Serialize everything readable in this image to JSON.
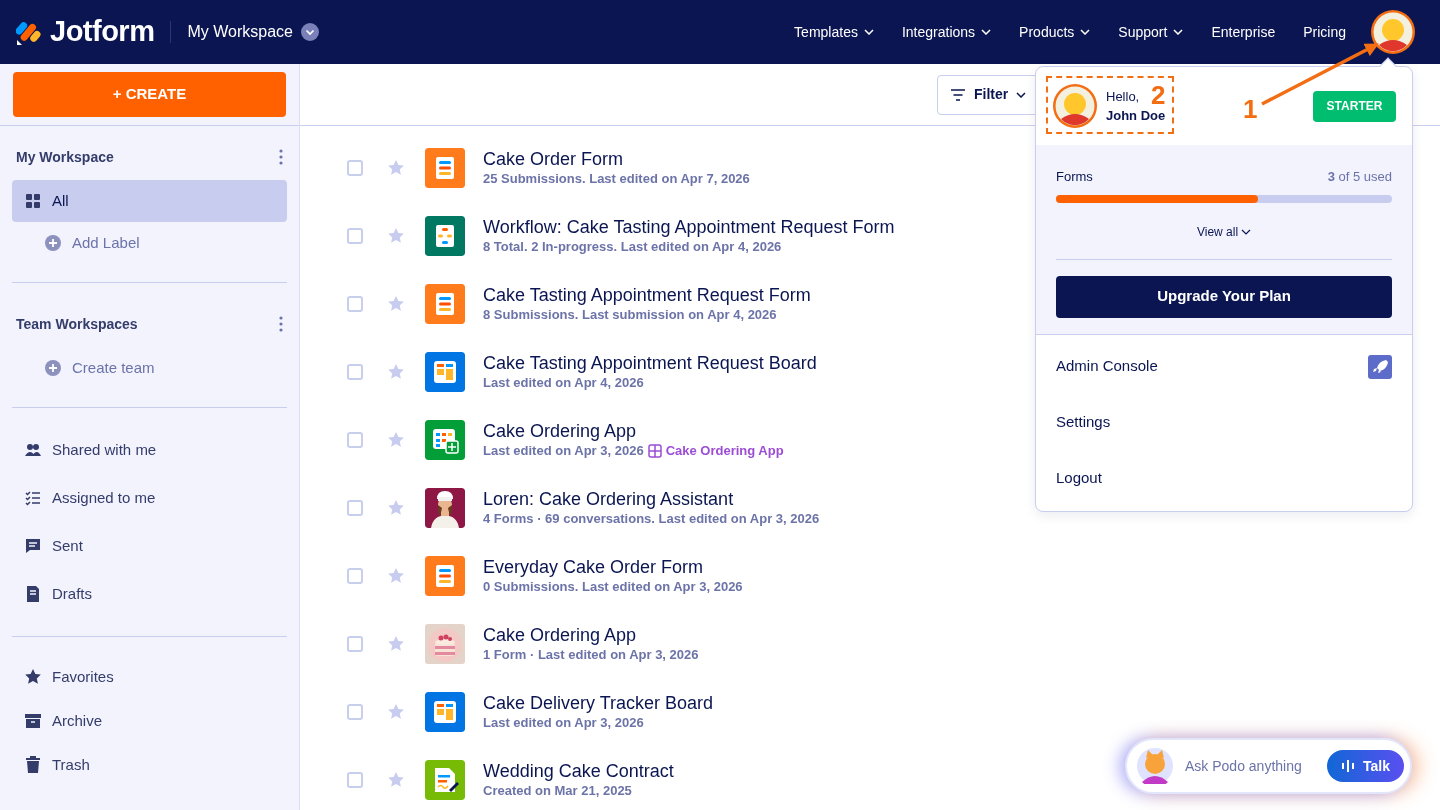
{
  "navbar": {
    "brand": "Jotform",
    "workspace": "My Workspace",
    "links": [
      {
        "label": "Templates",
        "has_menu": true
      },
      {
        "label": "Integrations",
        "has_menu": true
      },
      {
        "label": "Products",
        "has_menu": true
      },
      {
        "label": "Support",
        "has_menu": true
      },
      {
        "label": "Enterprise",
        "has_menu": false
      },
      {
        "label": "Pricing",
        "has_menu": false
      }
    ]
  },
  "sidebar": {
    "create_label": "+ CREATE",
    "sections": [
      {
        "title": "My Workspace",
        "items": [
          {
            "label": "All",
            "kind": "all",
            "selected": true
          },
          {
            "label": "Add Label",
            "kind": "add",
            "selected": false
          }
        ]
      },
      {
        "title": "Team Workspaces",
        "items": [
          {
            "label": "Create team",
            "kind": "add",
            "selected": false
          }
        ]
      },
      {
        "items": [
          {
            "label": "Shared with me",
            "kind": "shared",
            "selected": false
          },
          {
            "label": "Assigned to me",
            "kind": "assigned",
            "selected": false
          },
          {
            "label": "Sent",
            "kind": "sent",
            "selected": false
          },
          {
            "label": "Drafts",
            "kind": "drafts",
            "selected": false
          }
        ]
      },
      {
        "items": [
          {
            "label": "Favorites",
            "kind": "favorites",
            "selected": false
          },
          {
            "label": "Archive",
            "kind": "archive",
            "selected": false
          },
          {
            "label": "Trash",
            "kind": "trash",
            "selected": false
          }
        ]
      }
    ]
  },
  "toolbar": {
    "filter_label": "Filter"
  },
  "assets": [
    {
      "title": "Cake Order Form",
      "meta": "25 Submissions. Last edited on Apr 7, 2026",
      "kind": "form",
      "checked": false,
      "starred": false
    },
    {
      "title": "Workflow: Cake Tasting Appointment Request Form",
      "meta": "8 Total. 2 In-progress. Last edited on Apr 4, 2026",
      "kind": "workflow",
      "checked": false,
      "starred": false
    },
    {
      "title": "Cake Tasting Appointment Request Form",
      "meta": "8 Submissions. Last submission on Apr 4, 2026",
      "kind": "form",
      "checked": false,
      "starred": false
    },
    {
      "title": "Cake Tasting Appointment Request Board",
      "meta": "Last edited on Apr 4, 2026",
      "kind": "board",
      "checked": false,
      "starred": false
    },
    {
      "title": "Cake Ordering App",
      "meta": "Last edited on Apr 3, 2026",
      "link": "Cake Ordering App",
      "kind": "table",
      "checked": false,
      "starred": false
    },
    {
      "title": "Loren: Cake Ordering Assistant",
      "meta": "4 Forms · 69 conversations. Last edited on Apr 3, 2026",
      "kind": "agent",
      "checked": false,
      "starred": false
    },
    {
      "title": "Everyday Cake Order Form",
      "meta": "0 Submissions. Last edited on Apr 3, 2026",
      "kind": "form",
      "checked": false,
      "starred": false
    },
    {
      "title": "Cake Ordering App",
      "meta": "1 Form · Last edited on Apr 3, 2026",
      "kind": "app",
      "checked": false,
      "starred": false
    },
    {
      "title": "Cake Delivery Tracker Board",
      "meta": "Last edited on Apr 3, 2026",
      "kind": "board",
      "checked": false,
      "starred": false
    },
    {
      "title": "Wedding Cake Contract",
      "meta": "Created on Mar 21, 2025",
      "kind": "sign",
      "checked": false,
      "starred": false
    }
  ],
  "account_menu": {
    "greeting": "Hello,",
    "user_name": "John Doe",
    "plan": "STARTER",
    "usage": {
      "label": "Forms",
      "reading": "**3** of 5 used",
      "level": 0.6
    },
    "view_all": "View all",
    "upgrade": "Upgrade Your Plan",
    "items": [
      {
        "label": "Admin Console",
        "kind": "admin"
      },
      {
        "label": "Settings",
        "kind": "plain"
      },
      {
        "label": "Logout",
        "kind": "plain"
      }
    ]
  },
  "annotations": [
    {
      "label": "2"
    },
    {
      "label": "1"
    }
  ],
  "assistant": {
    "placeholder": "Ask Podo anything",
    "talk": "Talk"
  }
}
